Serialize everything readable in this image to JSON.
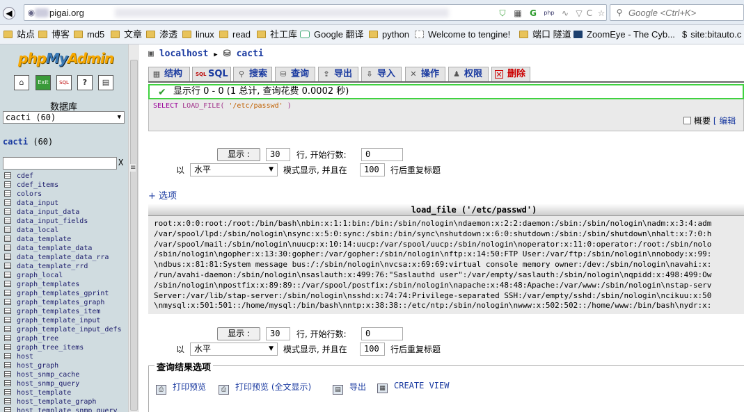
{
  "browser": {
    "url": "pigai.org",
    "search_placeholder": "Google <Ctrl+K>",
    "bookmarks": [
      "站点",
      "博客",
      "md5",
      "文章",
      "渗透",
      "linux",
      "read",
      "社工库",
      "Google 翻译",
      "python",
      "Welcome to tengine!",
      "端口 隧道",
      "ZoomEye - The Cyb...",
      "site:bitauto.c"
    ]
  },
  "sidebar": {
    "logo_php": "php",
    "logo_my": "My",
    "logo_admin": "Admin",
    "icons": [
      "home-icon",
      "exit-icon",
      "sql-icon",
      "help-icon",
      "docs-icon"
    ],
    "db_label": "数据库",
    "db_select": "cacti (60)",
    "db_name": "cacti",
    "db_count": "(60)",
    "filter_clear": "X",
    "tables": [
      "cdef",
      "cdef_items",
      "colors",
      "data_input",
      "data_input_data",
      "data_input_fields",
      "data_local",
      "data_template",
      "data_template_data",
      "data_template_data_rra",
      "data_template_rrd",
      "graph_local",
      "graph_templates",
      "graph_templates_gprint",
      "graph_templates_graph",
      "graph_templates_item",
      "graph_template_input",
      "graph_template_input_defs",
      "graph_tree",
      "graph_tree_items",
      "host",
      "host_graph",
      "host_snmp_cache",
      "host_snmp_query",
      "host_template",
      "host_template_graph",
      "host_template_snmp_query"
    ]
  },
  "breadcrumb": {
    "server": "localhost",
    "database": "cacti"
  },
  "tabs": [
    {
      "label": "结构",
      "icon": "structure-icon"
    },
    {
      "label": "SQL",
      "icon": "sql-icon"
    },
    {
      "label": "搜索",
      "icon": "search-icon"
    },
    {
      "label": "查询",
      "icon": "query-icon"
    },
    {
      "label": "导出",
      "icon": "export-icon"
    },
    {
      "label": "导入",
      "icon": "import-icon"
    },
    {
      "label": "操作",
      "icon": "operations-icon"
    },
    {
      "label": "权限",
      "icon": "privileges-icon"
    },
    {
      "label": "删除",
      "icon": "drop-icon"
    }
  ],
  "message": "显示行 0 - 0 (1 总计, 查询花费 0.0002 秒)",
  "sql": {
    "keyword": "SELECT",
    "function": "LOAD_FILE",
    "arg": "'/etc/passwd'"
  },
  "profiling_label": "概要",
  "edit_label": "[ 编辑",
  "navigation": {
    "show_button": "显示 :",
    "rows": "30",
    "start_label": "行, 开始行数:",
    "start": "0",
    "mode_prefix": "以",
    "mode": "水平",
    "mode_suffix": "模式显示, 并且在",
    "repeat": "100",
    "repeat_suffix": "行后重复标题"
  },
  "options_link": "+ 选项",
  "result": {
    "header": "load_file ('/etc/passwd')",
    "lines": [
      "root:x:0:0:root:/root:/bin/bash\\nbin:x:1:1:bin:/bin:/sbin/nologin\\ndaemon:x:2:2:daemon:/sbin:/sbin/nologin\\nadm:x:3:4:adm",
      "/var/spool/lpd:/sbin/nologin\\nsync:x:5:0:sync:/sbin:/bin/sync\\nshutdown:x:6:0:shutdown:/sbin:/sbin/shutdown\\nhalt:x:7:0:h",
      "/var/spool/mail:/sbin/nologin\\nuucp:x:10:14:uucp:/var/spool/uucp:/sbin/nologin\\noperator:x:11:0:operator:/root:/sbin/nolo",
      "/sbin/nologin\\ngopher:x:13:30:gopher:/var/gopher:/sbin/nologin\\nftp:x:14:50:FTP User:/var/ftp:/sbin/nologin\\nnobody:x:99:",
      "\\ndbus:x:81:81:System message bus:/:/sbin/nologin\\nvcsa:x:69:69:virtual console memory owner:/dev:/sbin/nologin\\navahi:x:",
      "/run/avahi-daemon:/sbin/nologin\\nsaslauth:x:499:76:\"Saslauthd user\":/var/empty/saslauth:/sbin/nologin\\nqpidd:x:498:499:Ow",
      "/sbin/nologin\\npostfix:x:89:89::/var/spool/postfix:/sbin/nologin\\napache:x:48:48:Apache:/var/www:/sbin/nologin\\nstap-serv",
      "Server:/var/lib/stap-server:/sbin/nologin\\nsshd:x:74:74:Privilege-separated SSH:/var/empty/sshd:/sbin/nologin\\ncikuu:x:50",
      "\\nmysql:x:501:501::/home/mysql:/bin/bash\\nntp:x:38:38::/etc/ntp:/sbin/nologin\\nwww:x:502:502::/home/www:/bin/bash\\nydr:x:"
    ]
  },
  "query_results": {
    "legend": "查询结果选项",
    "print": "打印预览",
    "print_full": "打印预览 (全文显示)",
    "export": "导出",
    "create_view": "CREATE VIEW"
  }
}
